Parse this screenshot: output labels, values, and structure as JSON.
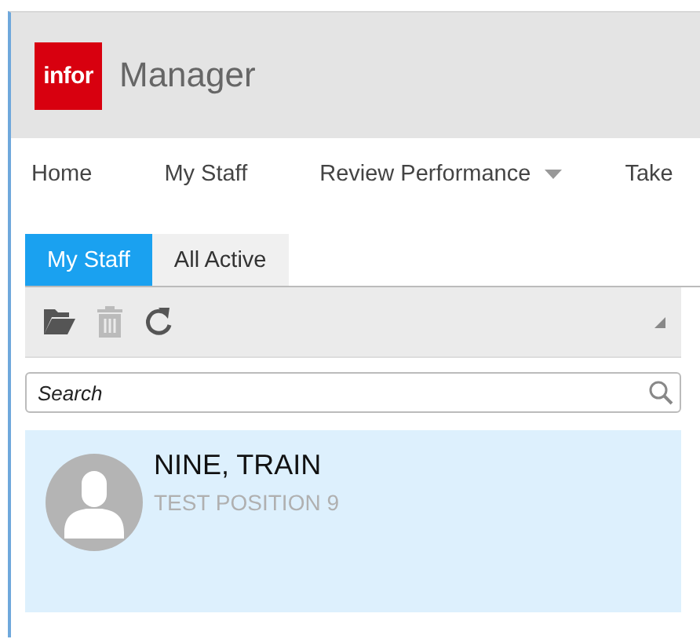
{
  "header": {
    "logo": "infor",
    "title": "Manager"
  },
  "nav": [
    {
      "label": "Home",
      "has_menu": false
    },
    {
      "label": "My Staff",
      "has_menu": false
    },
    {
      "label": "Review Performance",
      "has_menu": true
    },
    {
      "label": "Take",
      "has_menu": false
    }
  ],
  "tabs": [
    {
      "label": "My Staff",
      "selected": true
    },
    {
      "label": "All Active",
      "selected": false
    }
  ],
  "toolbar": [
    {
      "kind": "open",
      "disabled": false
    },
    {
      "kind": "delete",
      "disabled": true
    },
    {
      "kind": "refresh",
      "disabled": false
    }
  ],
  "search": {
    "placeholder": "Search"
  },
  "staff": [
    {
      "name": "NINE, TRAIN",
      "position": "TEST POSITION 9",
      "selected": true
    }
  ]
}
